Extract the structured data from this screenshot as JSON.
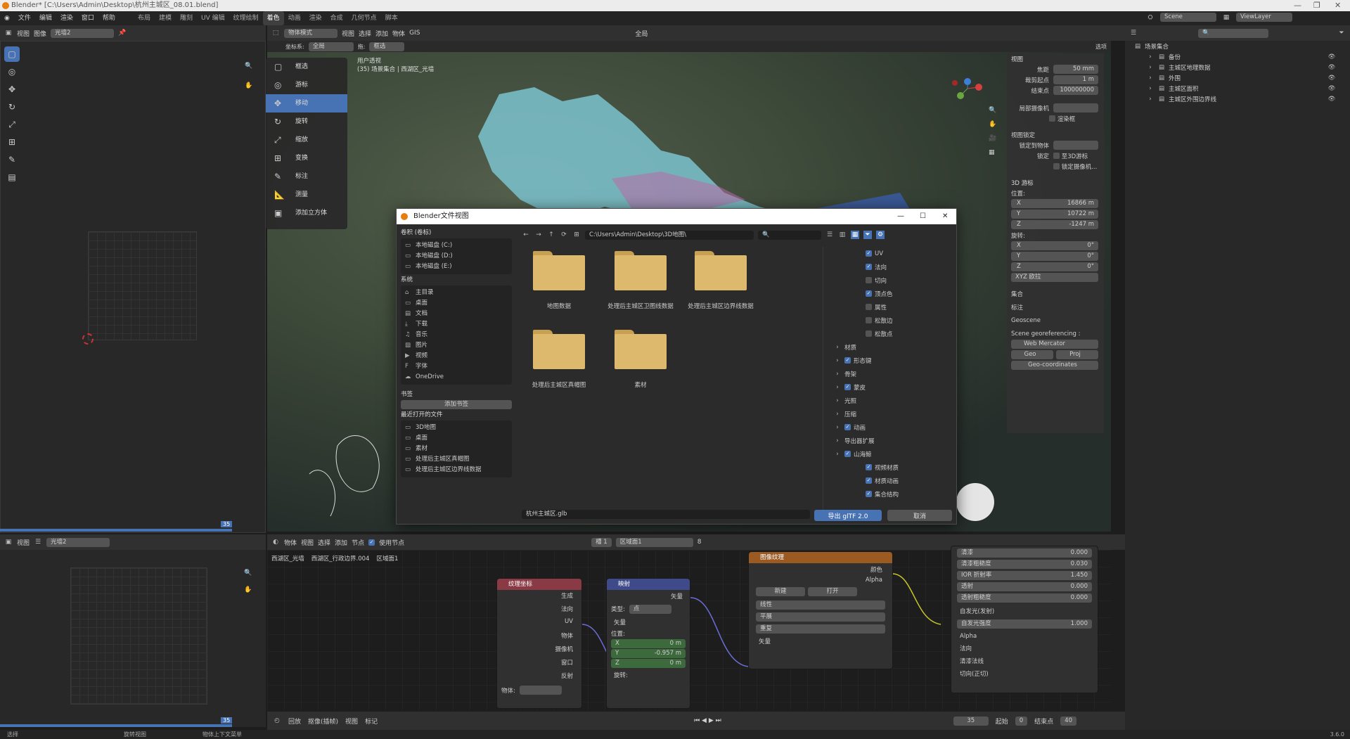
{
  "window": {
    "title": "Blender* [C:\\Users\\Admin\\Desktop\\杭州主城区_08.01.blend]"
  },
  "menu": [
    "文件",
    "编辑",
    "渲染",
    "窗口",
    "帮助"
  ],
  "workspaces": [
    "布局",
    "建模",
    "雕刻",
    "UV 编辑",
    "纹理绘制",
    "着色",
    "动画",
    "渲染",
    "合成",
    "几何节点",
    "脚本"
  ],
  "active_workspace": "着色",
  "scene": {
    "name": "Scene",
    "view_layer": "ViewLayer"
  },
  "image_editor_top": {
    "menu": [
      "视图",
      "图像"
    ],
    "image_name": "光墙2",
    "frame": "35"
  },
  "image_editor_bottom": {
    "menu": [
      "视图"
    ],
    "image_name": "光墙2",
    "frame": "35"
  },
  "viewport": {
    "mode": "物体模式",
    "menu": [
      "视图",
      "选择",
      "添加",
      "物体",
      "GIS"
    ],
    "coord_label": "坐标系:",
    "coord_value": "全局",
    "drag_label": "拖:",
    "select_value": "框选",
    "transform": "全局",
    "options": "选项",
    "overlay_text": "用户透视",
    "overlay_sub": "(35) 场景集合 | 西湖区_光墙",
    "tools": [
      {
        "icon": "▢",
        "label": "框选"
      },
      {
        "icon": "◎",
        "label": "游标"
      },
      {
        "icon": "✥",
        "label": "移动"
      },
      {
        "icon": "↻",
        "label": "旋转"
      },
      {
        "icon": "⤢",
        "label": "缩放"
      },
      {
        "icon": "⊞",
        "label": "变换"
      },
      {
        "icon": "✎",
        "label": "标注"
      },
      {
        "icon": "📐",
        "label": "测量"
      },
      {
        "icon": "▣",
        "label": "添加立方体"
      }
    ],
    "active_tool": "移动"
  },
  "npanel": {
    "view_title": "视图",
    "focal_label": "焦距",
    "focal": "50 mm",
    "clip_start_label": "裁剪起点",
    "clip_start": "1 m",
    "clip_end_label": "结束点",
    "clip_end": "100000000",
    "local_cam_label": "局部摄像机",
    "render_region": "渲染框",
    "view_lock": "视图锁定",
    "lock_obj_label": "锁定到物体",
    "lock_label": "锁定",
    "to_cursor": "至3D游标",
    "lock_cam": "锁定摄像机...",
    "cursor_title": "3D 游标",
    "location": "位置:",
    "loc": [
      {
        "axis": "X",
        "val": "16866 m"
      },
      {
        "axis": "Y",
        "val": "10722 m"
      },
      {
        "axis": "Z",
        "val": "-1247 m"
      }
    ],
    "rotation": "旋转:",
    "rot": [
      {
        "axis": "X",
        "val": "0°"
      },
      {
        "axis": "Y",
        "val": "0°"
      },
      {
        "axis": "Z",
        "val": "0°"
      }
    ],
    "euler": "XYZ 欧拉",
    "collection": "集合",
    "annotation": "标注",
    "geoscene": "Geoscene",
    "georef": "Scene georeferencing :",
    "crs": "Web Mercator",
    "geo_btn": "Geo",
    "proj_btn": "Proj",
    "geo_coords": "Geo-coordinates"
  },
  "outliner": {
    "root": "场景集合",
    "items": [
      {
        "label": "备份"
      },
      {
        "label": "主城区地理数据"
      },
      {
        "label": "外围"
      },
      {
        "label": "主城区面积"
      },
      {
        "label": "主城区外围边界线"
      }
    ]
  },
  "dialog": {
    "title": "Blender文件视图",
    "path": "C:\\Users\\Admin\\Desktop\\3D地图\\",
    "volumes_title": "卷积 (卷标)",
    "volumes": [
      "本地磁盘 (C:)",
      "本地磁盘 (D:)",
      "本地磁盘 (E:)"
    ],
    "system_title": "系统",
    "system": [
      {
        "icon": "⌂",
        "label": "主目录"
      },
      {
        "icon": "▭",
        "label": "桌面"
      },
      {
        "icon": "▤",
        "label": "文档"
      },
      {
        "icon": "⤓",
        "label": "下载"
      },
      {
        "icon": "♫",
        "label": "音乐"
      },
      {
        "icon": "▨",
        "label": "图片"
      },
      {
        "icon": "▶",
        "label": "视频"
      },
      {
        "icon": "F",
        "label": "字体"
      },
      {
        "icon": "☁",
        "label": "OneDrive"
      }
    ],
    "bookmarks_title": "书签",
    "add_bookmark": "添加书签",
    "recent_title": "最近打开的文件",
    "recent": [
      "3D地图",
      "桌面",
      "素材",
      "处理后主城区真帽图",
      "处理后主城区边界线数据"
    ],
    "folders": [
      "地图数据",
      "处理后主城区卫图线数据",
      "处理后主城区边界线数据",
      "处理后主城区真帽图",
      "素材"
    ],
    "options_top": [
      {
        "label": "UV",
        "on": true
      },
      {
        "label": "法向",
        "on": true
      },
      {
        "label": "切向",
        "on": false
      },
      {
        "label": "顶点色",
        "on": true
      },
      {
        "label": "属性",
        "on": false
      },
      {
        "label": "松散边",
        "on": false
      },
      {
        "label": "松散点",
        "on": false
      }
    ],
    "options_groups": [
      {
        "label": "材质",
        "cb": false
      },
      {
        "label": "形态键",
        "cb": true
      },
      {
        "label": "骨架",
        "cb": false
      },
      {
        "label": "蒙皮",
        "cb": true
      },
      {
        "label": "光照",
        "cb": false
      },
      {
        "label": "压缩",
        "cb": false
      },
      {
        "label": "动画",
        "cb": true
      },
      {
        "label": "导出器扩展",
        "cb": false
      },
      {
        "label": "山海鲸",
        "cb": true
      }
    ],
    "options_bottom": [
      {
        "label": "视频材质",
        "on": true
      },
      {
        "label": "材质动画",
        "on": true
      },
      {
        "label": "集合结构",
        "on": true
      }
    ],
    "filename": "杭州主城区.glb",
    "export_btn": "导出 glTF 2.0",
    "cancel_btn": "取消"
  },
  "node_editor": {
    "menu": [
      "物体",
      "视图",
      "选择",
      "添加",
      "节点"
    ],
    "use_nodes": "使用节点",
    "slot": "槽 1",
    "material": "区域面1",
    "users": "8",
    "breadcrumb": [
      "西湖区_光墙",
      "西湖区_行政边界.004",
      "区域面1"
    ],
    "texcoord": {
      "title": "纹理坐标",
      "outputs": [
        "生成",
        "法向",
        "UV",
        "物体",
        "摄像机",
        "窗口",
        "反射"
      ],
      "object_label": "物体:"
    },
    "mapping": {
      "title": "映射",
      "out": "矢量",
      "type_label": "类型:",
      "type": "点",
      "vector": "矢量",
      "pos_label": "位置:",
      "pos": [
        {
          "axis": "X",
          "val": "0 m"
        },
        {
          "axis": "Y",
          "val": "-0.957 m"
        },
        {
          "axis": "Z",
          "val": "0 m"
        }
      ],
      "rot_label": "旋转:"
    },
    "imgtex": {
      "title": "图像纹理",
      "out_color": "颜色",
      "out_alpha": "Alpha",
      "new_btn": "新建",
      "open_btn": "打开",
      "interp": "线性",
      "proj": "平展",
      "ext": "重复",
      "vector": "矢量"
    },
    "bsdf": [
      {
        "label": "清漆",
        "val": "0.000"
      },
      {
        "label": "清漆粗糙度",
        "val": "0.030"
      },
      {
        "label": "IOR 折射率",
        "val": "1.450"
      },
      {
        "label": "透射",
        "val": "0.000"
      },
      {
        "label": "透射粗糙度",
        "val": "0.000"
      }
    ],
    "bsdf_emission": "自发光(发射)",
    "bsdf_strength_label": "自发光强度",
    "bsdf_strength": "1.000",
    "bsdf_tail": [
      "Alpha",
      "法向",
      "清漆法线",
      "切向(正切)"
    ]
  },
  "timeline": {
    "menu": [
      "回放",
      "抠像(插帧)",
      "视图",
      "标记"
    ],
    "frame": "35",
    "start_label": "起始",
    "start": "0",
    "end_label": "结束点",
    "end": "40"
  },
  "status": {
    "left": "选择",
    "mid": "旋转视图",
    "right": "物体上下文菜单",
    "version": "3.6.0"
  }
}
